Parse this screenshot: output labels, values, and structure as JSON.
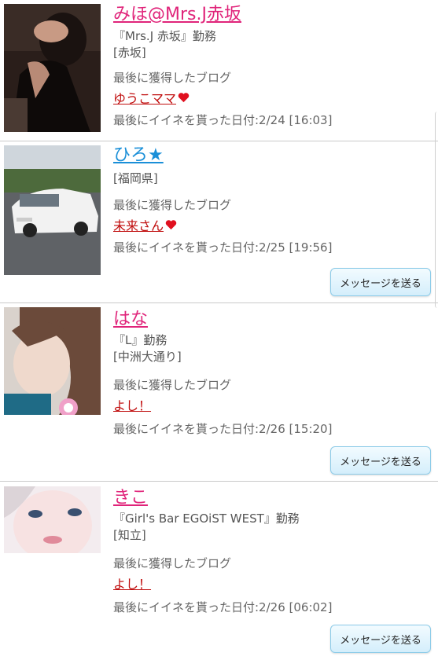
{
  "users": [
    {
      "name": "みほ@Mrs.J赤坂",
      "workplace": "『Mrs.J 赤坂』勤務",
      "area": "[赤坂]",
      "blog_label": "最後に獲得したブログ",
      "blog_title": "ゆうこママ",
      "blog_heart": true,
      "last_like": "最後にイイネを貰った日付:2/24 [16:03]",
      "message_button": ""
    },
    {
      "name": "ひろ★",
      "workplace": "",
      "area": "[福岡県]",
      "blog_label": "最後に獲得したブログ",
      "blog_title": "未来さん",
      "blog_heart": true,
      "last_like": "最後にイイネを貰った日付:2/25 [19:56]",
      "message_button": "メッセージを送る"
    },
    {
      "name": "はな",
      "workplace": "『L』勤務",
      "area": "[中洲大通り]",
      "blog_label": "最後に獲得したブログ",
      "blog_title": "よし！",
      "blog_heart": false,
      "last_like": "最後にイイネを貰った日付:2/26 [15:20]",
      "message_button": "メッセージを送る"
    },
    {
      "name": "きこ",
      "workplace": "『Girl's Bar EGOiST WEST』勤務",
      "area": "[知立]",
      "blog_label": "最後に獲得したブログ",
      "blog_title": "よし！",
      "blog_heart": false,
      "last_like": "最後にイイネを貰った日付:2/26 [06:02]",
      "message_button": "メッセージを送る"
    }
  ],
  "colors": {
    "name_pink": "#e0247a",
    "name_blue": "#1a8fd8",
    "blog_red": "#c00d0d",
    "heart_red": "#e0101f"
  }
}
